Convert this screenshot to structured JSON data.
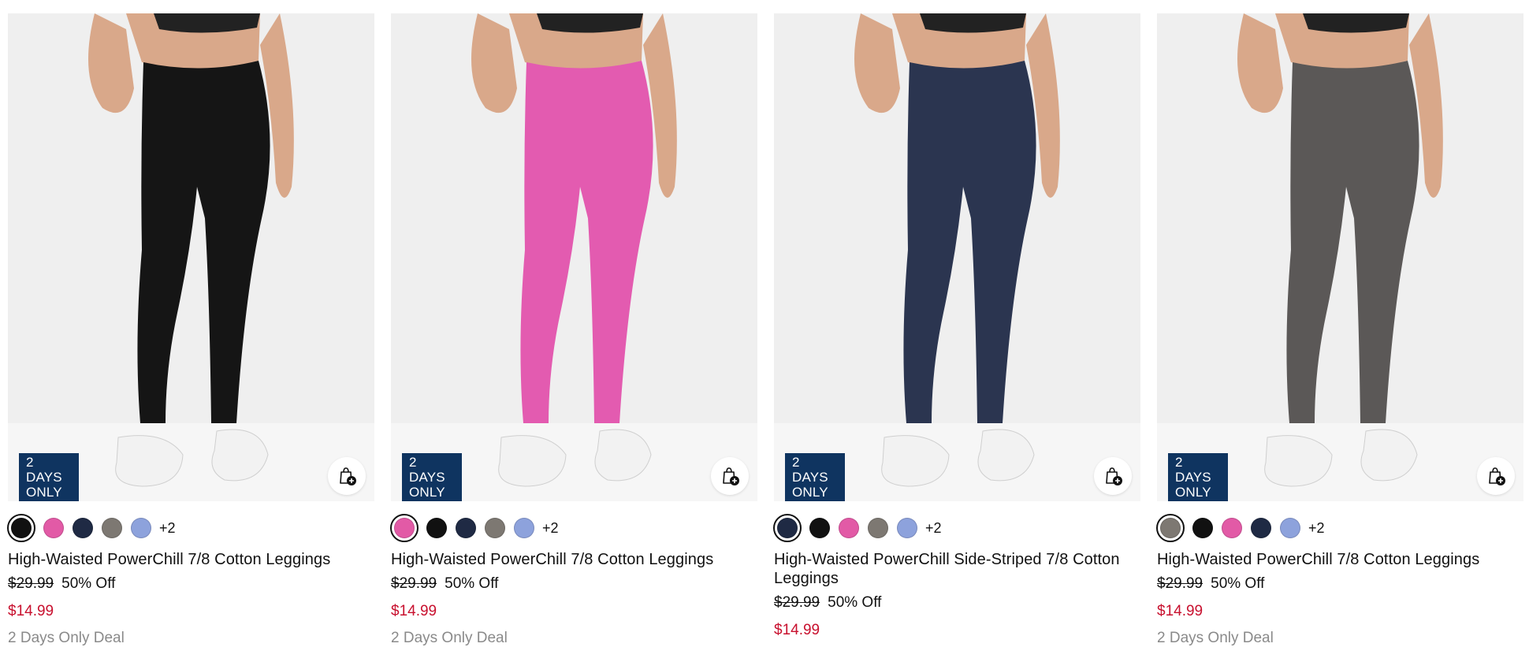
{
  "products": [
    {
      "title": "High-Waisted PowerChill 7/8 Cotton Leggings",
      "badge": [
        "2 DAYS",
        "ONLY"
      ],
      "swatches": [
        "#111111",
        "#e25aa6",
        "#1f2a44",
        "#7d7872",
        "#8da2dc"
      ],
      "more": "+2",
      "original_price": "$29.99",
      "discount": "50% Off",
      "sale_price": "$14.99",
      "deal": "2 Days Only Deal",
      "legging_color": "#151515"
    },
    {
      "title": "High-Waisted PowerChill 7/8 Cotton Leggings",
      "badge": [
        "2 DAYS",
        "ONLY"
      ],
      "swatches": [
        "#e25aa6",
        "#111111",
        "#1f2a44",
        "#7d7872",
        "#8da2dc"
      ],
      "more": "+2",
      "original_price": "$29.99",
      "discount": "50% Off",
      "sale_price": "$14.99",
      "deal": "2 Days Only Deal",
      "legging_color": "#e35bb0"
    },
    {
      "title": "High-Waisted PowerChill Side-Striped 7/8 Cotton Leggings",
      "badge": [
        "2 DAYS",
        "ONLY"
      ],
      "swatches": [
        "#1f2a44",
        "#111111",
        "#e25aa6",
        "#7d7872",
        "#8da2dc"
      ],
      "more": "+2",
      "original_price": "$29.99",
      "discount": "50% Off",
      "sale_price": "$14.99",
      "deal": "",
      "legging_color": "#2b3550"
    },
    {
      "title": "High-Waisted PowerChill 7/8 Cotton Leggings",
      "badge": [
        "2 DAYS",
        "ONLY"
      ],
      "swatches": [
        "#7d7872",
        "#111111",
        "#e25aa6",
        "#1f2a44",
        "#8da2dc"
      ],
      "more": "+2",
      "original_price": "$29.99",
      "discount": "50% Off",
      "sale_price": "$14.99",
      "deal": "2 Days Only Deal",
      "legging_color": "#5b5857"
    }
  ],
  "colors": {
    "badge_bg": "#0f3460",
    "sale_price": "#c8102e",
    "deal_text": "#8a8a8a",
    "photo_bg": "#efefef"
  },
  "icons": {
    "bag": "shopping-bag-plus-icon",
    "photo": "product-photo"
  }
}
